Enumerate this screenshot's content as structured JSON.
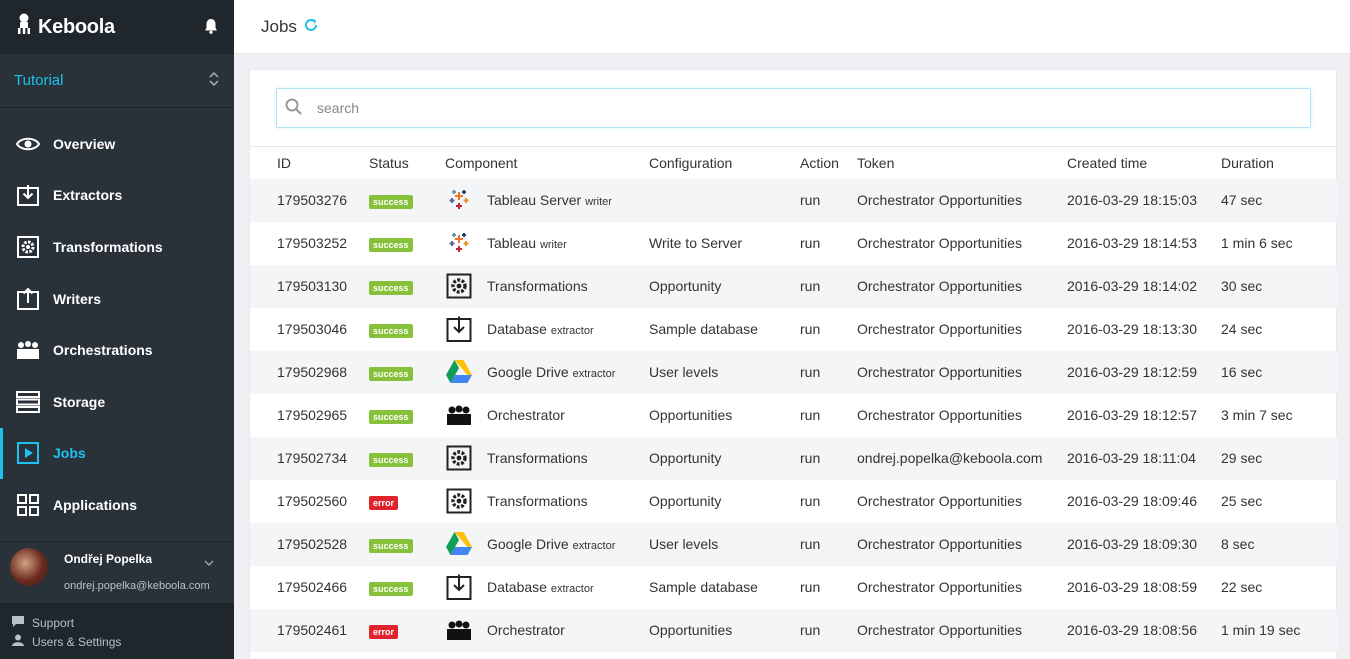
{
  "brand": {
    "name": "Keboola"
  },
  "project": {
    "name": "Tutorial"
  },
  "nav": [
    {
      "label": "Overview",
      "icon": "eye-icon"
    },
    {
      "label": "Extractors",
      "icon": "extractor-icon"
    },
    {
      "label": "Transformations",
      "icon": "gear-box-icon"
    },
    {
      "label": "Writers",
      "icon": "writer-icon"
    },
    {
      "label": "Orchestrations",
      "icon": "orchestration-icon"
    },
    {
      "label": "Storage",
      "icon": "storage-icon"
    },
    {
      "label": "Jobs",
      "icon": "play-icon"
    },
    {
      "label": "Applications",
      "icon": "grid-icon"
    }
  ],
  "user": {
    "name": "Ondřej Popelka",
    "email": "ondrej.popelka@keboola.com"
  },
  "footer": {
    "support": "Support",
    "settings": "Users & Settings"
  },
  "page": {
    "title": "Jobs"
  },
  "search": {
    "placeholder": "search"
  },
  "table": {
    "headers": [
      "ID",
      "Status",
      "Component",
      "Configuration",
      "Action",
      "Token",
      "Created time",
      "Duration"
    ],
    "rows": [
      {
        "id": "179503276",
        "status": "success",
        "icon": "tableau",
        "component": "Tableau Server",
        "type": "writer",
        "configuration": "",
        "action": "run",
        "token": "Orchestrator Opportunities",
        "created": "2016-03-29 18:15:03",
        "duration": "47 sec"
      },
      {
        "id": "179503252",
        "status": "success",
        "icon": "tableau",
        "component": "Tableau",
        "type": "writer",
        "configuration": "Write to Server",
        "action": "run",
        "token": "Orchestrator Opportunities",
        "created": "2016-03-29 18:14:53",
        "duration": "1 min 6 sec"
      },
      {
        "id": "179503130",
        "status": "success",
        "icon": "transformation",
        "component": "Transformations",
        "type": "",
        "configuration": "Opportunity",
        "action": "run",
        "token": "Orchestrator Opportunities",
        "created": "2016-03-29 18:14:02",
        "duration": "30 sec"
      },
      {
        "id": "179503046",
        "status": "success",
        "icon": "database",
        "component": "Database",
        "type": "extractor",
        "configuration": "Sample database",
        "action": "run",
        "token": "Orchestrator Opportunities",
        "created": "2016-03-29 18:13:30",
        "duration": "24 sec"
      },
      {
        "id": "179502968",
        "status": "success",
        "icon": "gdrive",
        "component": "Google Drive",
        "type": "extractor",
        "configuration": "User levels",
        "action": "run",
        "token": "Orchestrator Opportunities",
        "created": "2016-03-29 18:12:59",
        "duration": "16 sec"
      },
      {
        "id": "179502965",
        "status": "success",
        "icon": "orchestrator",
        "component": "Orchestrator",
        "type": "",
        "configuration": "Opportunities",
        "action": "run",
        "token": "Orchestrator Opportunities",
        "created": "2016-03-29 18:12:57",
        "duration": "3 min 7 sec"
      },
      {
        "id": "179502734",
        "status": "success",
        "icon": "transformation",
        "component": "Transformations",
        "type": "",
        "configuration": "Opportunity",
        "action": "run",
        "token": "ondrej.popelka@keboola.com",
        "created": "2016-03-29 18:11:04",
        "duration": "29 sec"
      },
      {
        "id": "179502560",
        "status": "error",
        "icon": "transformation",
        "component": "Transformations",
        "type": "",
        "configuration": "Opportunity",
        "action": "run",
        "token": "Orchestrator Opportunities",
        "created": "2016-03-29 18:09:46",
        "duration": "25 sec"
      },
      {
        "id": "179502528",
        "status": "success",
        "icon": "gdrive",
        "component": "Google Drive",
        "type": "extractor",
        "configuration": "User levels",
        "action": "run",
        "token": "Orchestrator Opportunities",
        "created": "2016-03-29 18:09:30",
        "duration": "8 sec"
      },
      {
        "id": "179502466",
        "status": "success",
        "icon": "database",
        "component": "Database",
        "type": "extractor",
        "configuration": "Sample database",
        "action": "run",
        "token": "Orchestrator Opportunities",
        "created": "2016-03-29 18:08:59",
        "duration": "22 sec"
      },
      {
        "id": "179502461",
        "status": "error",
        "icon": "orchestrator",
        "component": "Orchestrator",
        "type": "",
        "configuration": "Opportunities",
        "action": "run",
        "token": "Orchestrator Opportunities",
        "created": "2016-03-29 18:08:56",
        "duration": "1 min 19 sec"
      }
    ]
  },
  "colors": {
    "accent": "#1ec0f0",
    "sidebar": "#2a3239",
    "success": "#87c03a",
    "error": "#e0242e"
  }
}
